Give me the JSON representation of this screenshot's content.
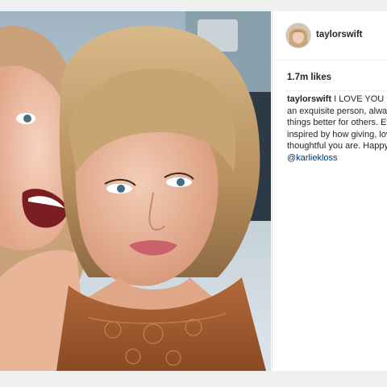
{
  "post": {
    "username": "taylorswift",
    "likes": "1.7m likes",
    "caption": {
      "username": "taylorswift",
      "line1": "I LOVE YOU KA",
      "line2": "an exquisite person, alway",
      "line3": "things better for others. Ev",
      "line4": "inspired by how giving, lov",
      "line5": "thoughtful you are. Happy",
      "mention": "@karliekloss"
    }
  },
  "colors": {
    "background": "#f0f0f0",
    "panel": "#ffffff",
    "text": "#262626",
    "mention": "#003569"
  },
  "icons": {
    "avatar": "profile-photo"
  }
}
